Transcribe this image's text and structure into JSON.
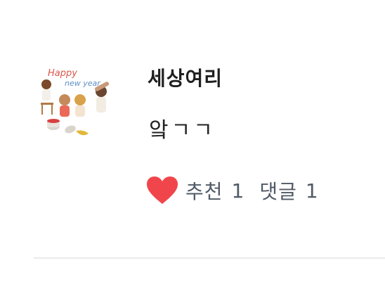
{
  "post": {
    "author": "세상여리",
    "text": "앜ㄱㄱ",
    "avatar": {
      "caption_line1": "Happy",
      "caption_line2": "new year"
    },
    "recommend_label": "추천",
    "recommend_count": "1",
    "comment_label": "댓글",
    "comment_count": "1"
  },
  "colors": {
    "heart": "#f0464b",
    "meta_text": "#505a66",
    "divider": "#ebebeb"
  },
  "icons": {
    "recommend": "heart-icon"
  }
}
